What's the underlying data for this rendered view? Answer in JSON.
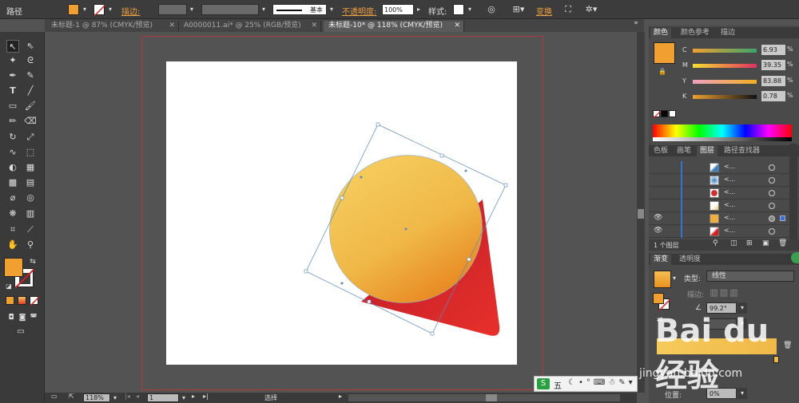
{
  "control_bar": {
    "object_type": "路径",
    "fill_color": "#f0a030",
    "stroke_label": "描边",
    "stroke_weight": "",
    "profile_label": "基本",
    "opacity_label": "不透明度",
    "opacity_value": "100%",
    "style_label": "样式",
    "transform_label": "变换"
  },
  "tabs": [
    {
      "label": "未标题-1 @ 87% (CMYK/预览)"
    },
    {
      "label": "A0000011.ai* @ 25% (RGB/预览)"
    },
    {
      "label": "未标题-10* @ 118% (CMYK/预览)"
    }
  ],
  "status": {
    "zoom": "118%",
    "page": "1",
    "tool": "选择"
  },
  "color_panel": {
    "tabs": [
      "颜色",
      "颜色参考",
      "描边"
    ],
    "fill_color": "#f0a030",
    "rows": [
      {
        "key": "C",
        "value": "6.93",
        "unit": "%"
      },
      {
        "key": "M",
        "value": "39.35",
        "unit": "%"
      },
      {
        "key": "Y",
        "value": "83.88",
        "unit": "%"
      },
      {
        "key": "K",
        "value": "0.78",
        "unit": "%"
      }
    ]
  },
  "layers_panel": {
    "tabs": [
      "色板",
      "画笔",
      "图层",
      "路径查找器"
    ],
    "rows": [
      {
        "name": "<...",
        "eye": false
      },
      {
        "name": "<...",
        "eye": false
      },
      {
        "name": "<...",
        "eye": false
      },
      {
        "name": "<...",
        "eye": false
      },
      {
        "name": "<...",
        "eye": true
      },
      {
        "name": "<...",
        "eye": true
      }
    ],
    "footer": "1 个图层"
  },
  "gradient_panel": {
    "tabs": [
      "渐变",
      "透明度"
    ],
    "type_label": "类型",
    "type_value": "线性",
    "stroke_label": "描边",
    "angle_value": "99.2°",
    "position_label": "位置",
    "position_value": "0%"
  },
  "ime": {
    "label": "五"
  },
  "watermark": {
    "text": "Bai du 经验",
    "url": "jingyan.baidu.com"
  }
}
